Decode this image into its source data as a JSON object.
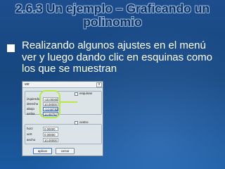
{
  "slide": {
    "title": "2.6.3 Un ejemplo – Graficando un polinomio",
    "bullet_text": "Realizando algunos ajustes  en el menú ver y luego dando clic en esquinas como los que se muestran"
  },
  "dialog": {
    "title": "ver",
    "close_glyph": "x",
    "esquinas_label": "esquinas",
    "fields": [
      {
        "label": "izquierdo",
        "value": "-10.00000"
      },
      {
        "label": "derecho",
        "value": "10.00000"
      },
      {
        "label": "abajo",
        "value": "-14.66752"
      },
      {
        "label": "arriba",
        "value": "14.66752"
      }
    ],
    "centro_label": "centro",
    "center_fields": [
      {
        "label": "horz",
        "value": "0.00000"
      },
      {
        "label": "vert",
        "value": "0.00000"
      },
      {
        "label": "ancho",
        "value": "10.00000"
      }
    ],
    "apply_label": "aplicar",
    "cancel_label": "cerrar"
  },
  "colors": {
    "background": "#1d4d8c",
    "title": "#0f2f5e",
    "highlight": "#b9e84a"
  }
}
